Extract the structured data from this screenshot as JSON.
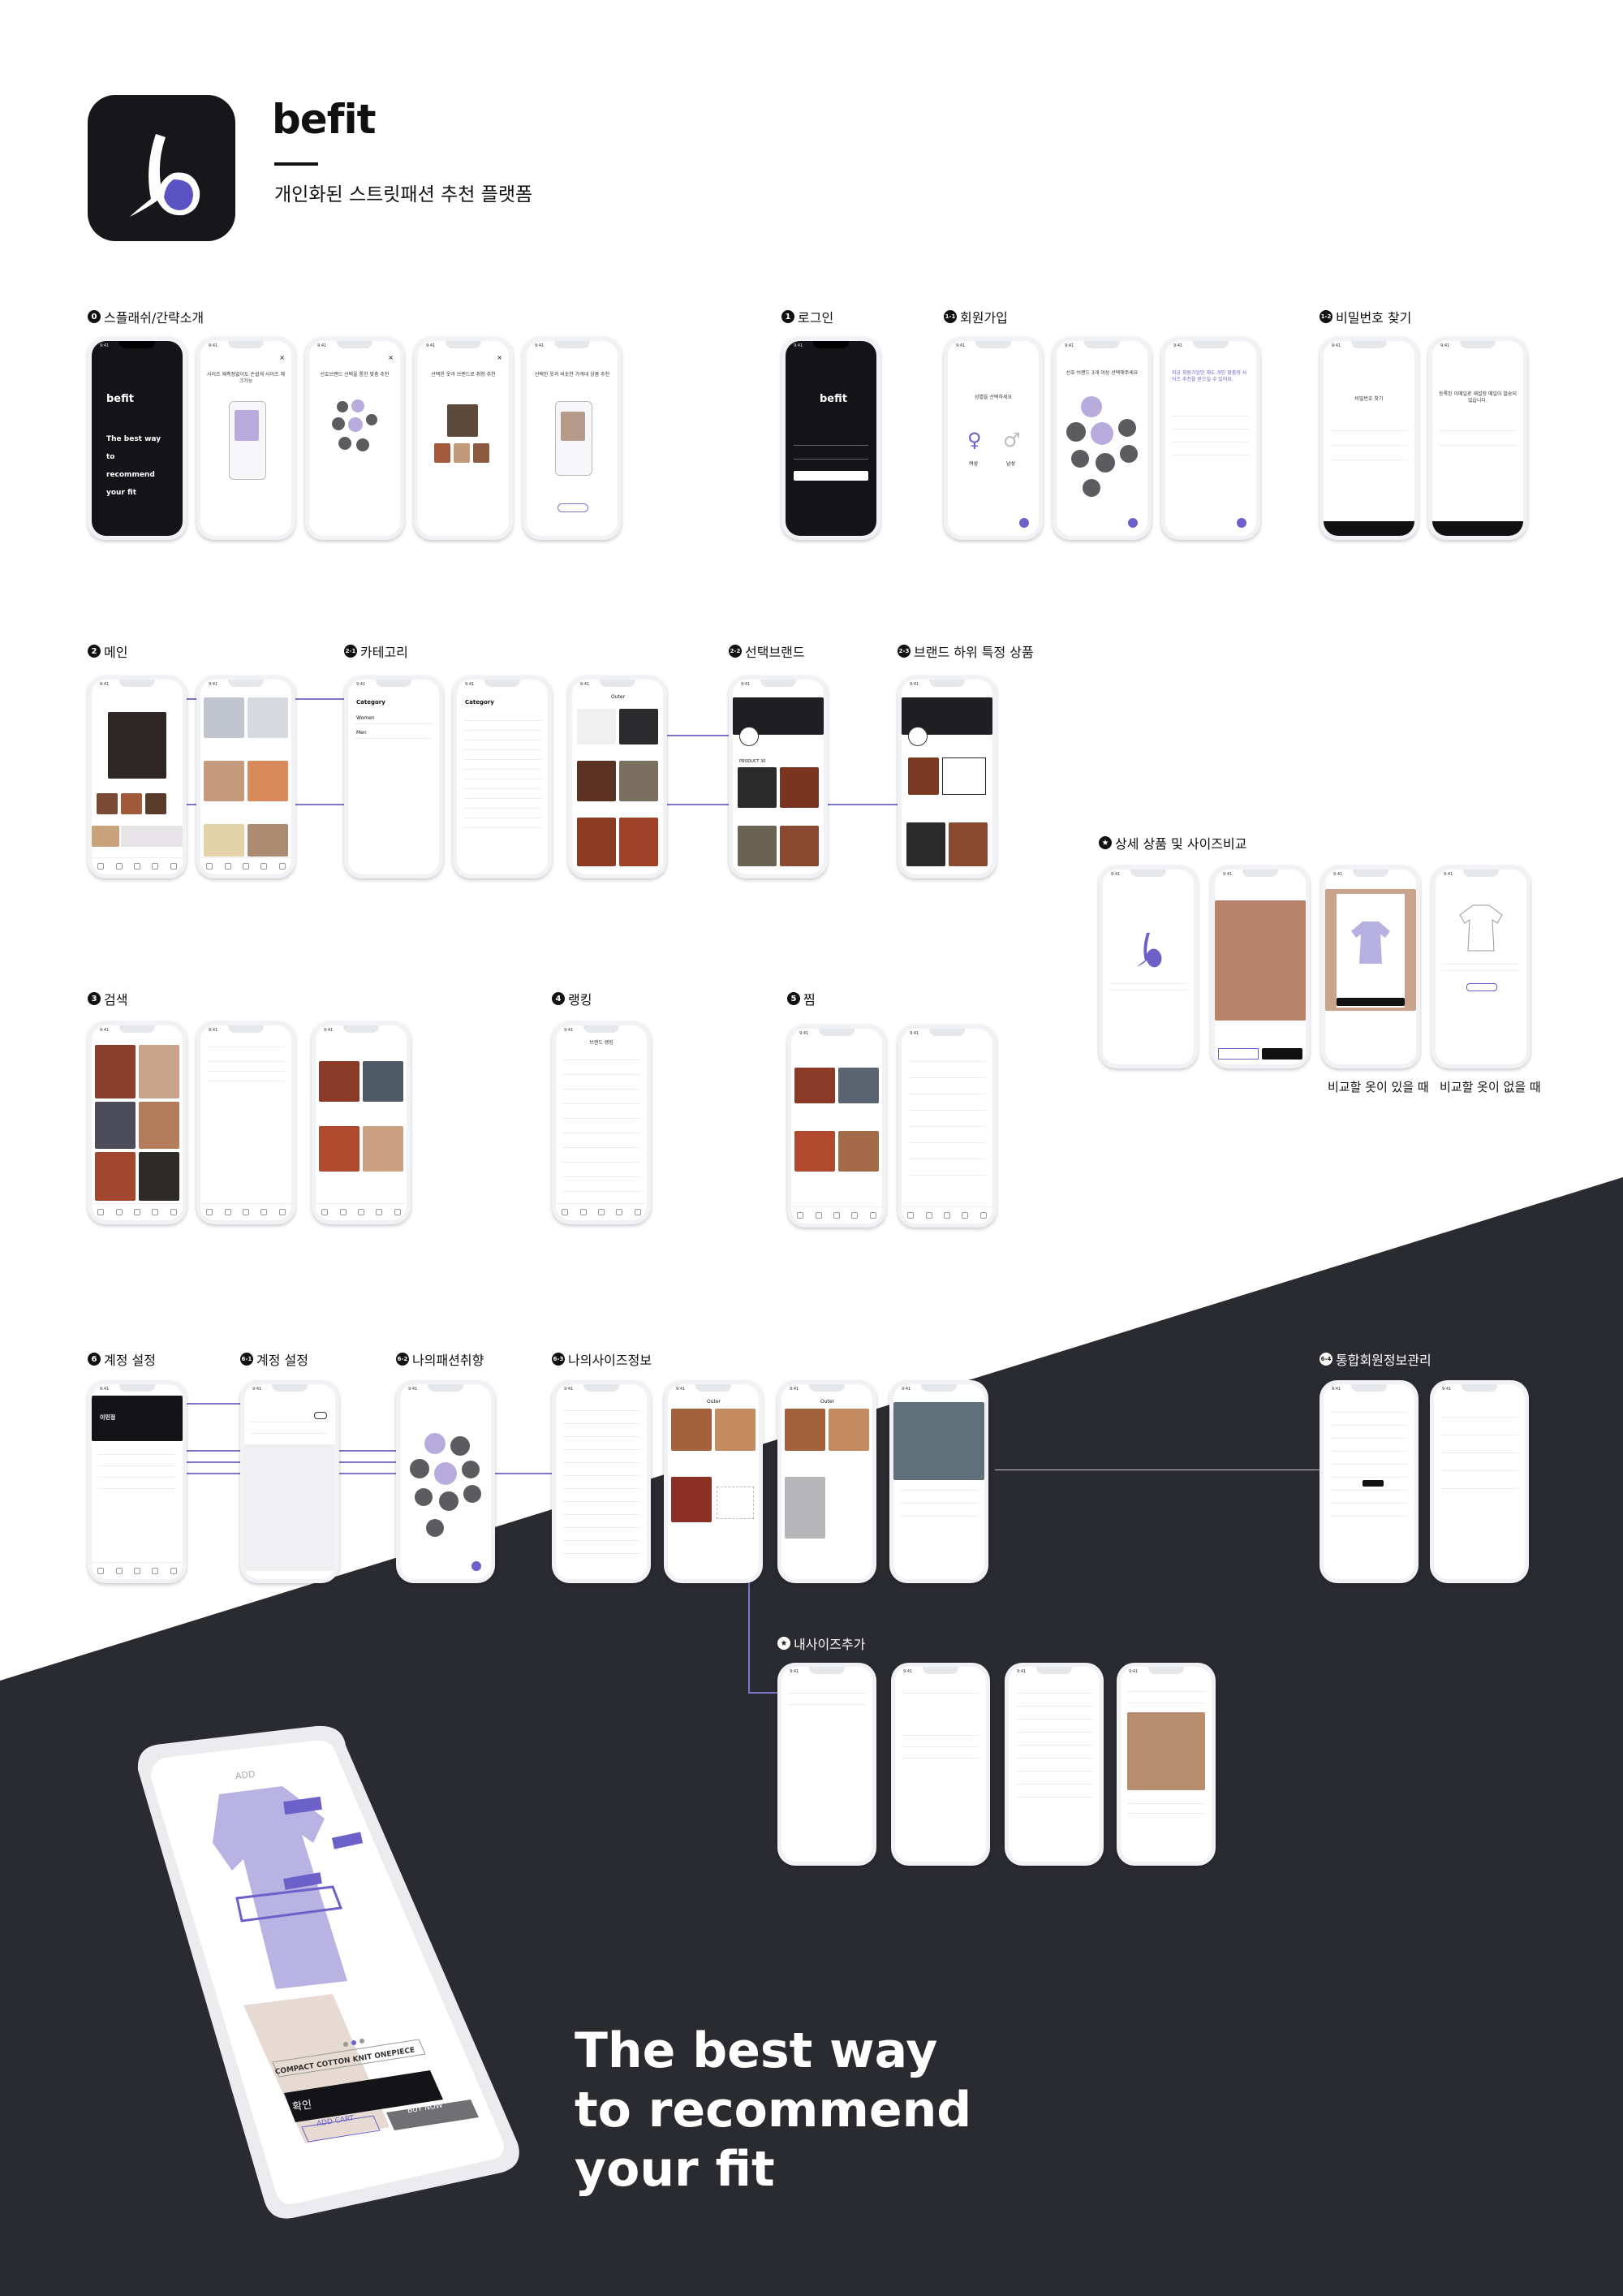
{
  "header": {
    "brand": "befit",
    "subtitle": "개인화된 스트릿패션 추천 플랫폼"
  },
  "sections": {
    "splash": {
      "num": "0",
      "label": "스플래쉬/간략소개"
    },
    "login": {
      "num": "1",
      "label": "로그인"
    },
    "signup": {
      "num": "1-1",
      "label": "회원가입"
    },
    "find_pw": {
      "num": "1-2",
      "label": "비밀번호 찾기"
    },
    "main": {
      "num": "2",
      "label": "메인"
    },
    "category": {
      "num": "2-1",
      "label": "카테고리"
    },
    "brand": {
      "num": "2-2",
      "label": "선택브랜드"
    },
    "brand_item": {
      "num": "2-3",
      "label": "브랜드 하위 특정 상품"
    },
    "detail": {
      "num": "★",
      "label": "상세 상품 및 사이즈비교"
    },
    "search": {
      "num": "3",
      "label": "검색"
    },
    "ranking": {
      "num": "4",
      "label": "랭킹"
    },
    "like": {
      "num": "5",
      "label": "찜"
    },
    "account": {
      "num": "6",
      "label": "계정 설정"
    },
    "account2": {
      "num": "6-1",
      "label": "계정 설정"
    },
    "taste": {
      "num": "6-2",
      "label": "나의패션취향"
    },
    "mysize": {
      "num": "6-3",
      "label": "나의사이즈정보"
    },
    "member": {
      "num": "6-4",
      "label": "통합회원정보관리"
    },
    "add_size": {
      "num": "★",
      "label": "내사이즈추가"
    }
  },
  "captions": {
    "with_compare": "비교할 옷이 있을 때",
    "without_compare": "비교할 옷이 없을 때"
  },
  "screens": {
    "splash_logo": "befit",
    "splash_tagline": "The best way to recommend your fit",
    "intro1": "사이즈 재측정없이도 손쉽게 사이즈 체크가능",
    "intro2": "선호브랜드 선택을 통한 맞춤 추천",
    "intro3": "선택한 옷과 브랜드로 취향 추천",
    "intro4": "선택한 옷과 비슷한 가격대 상품 추천",
    "login_logo": "befit",
    "gender_title": "성별을 선택하세요",
    "gender_female": "여성",
    "gender_male": "남성",
    "brand_select": "선호 브랜드 3개 이상 선택해주세요",
    "signup_info": "지금 회원가입만 해도 개인 맞춤형 사이즈 추천을 받으실 수 있어요.",
    "find_pw_title": "비밀번호 찾기",
    "find_pw_msg": "등록된 이메일로 재설정 메일이 발송되었습니다.",
    "cat_title": "Category",
    "cat_women": "Women",
    "cat_men": "Men",
    "outer": "Outer",
    "brand_label": "PRODUCT 30",
    "ranking_title": "브랜드 랭킹",
    "account_name": "이민정",
    "tshirt_name": "COMPACT COTTON KNIT ONEPIECE",
    "confirm": "확인",
    "add_cart": "ADD CART",
    "buy_now": "BUY NOW",
    "add_title": "ADD"
  },
  "tagline": {
    "line1": "The best way",
    "line2": "to recommend",
    "line3": "your fit"
  },
  "colors": {
    "dark": "#2a2b31",
    "accent": "#6b61c8",
    "lavender": "#c9c2ec"
  }
}
